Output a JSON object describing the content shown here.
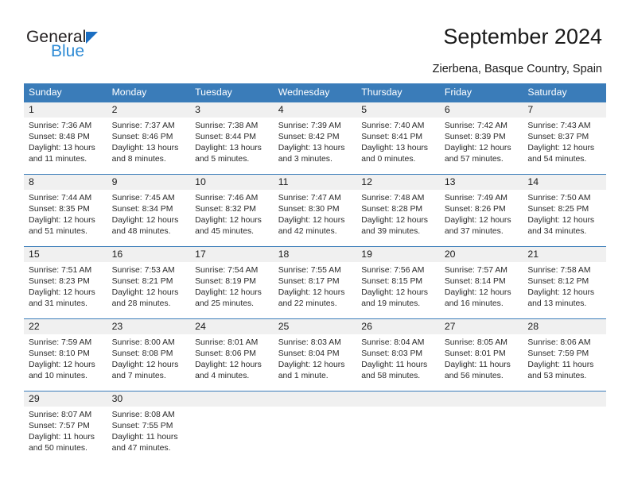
{
  "brand": {
    "name_part1": "General",
    "name_part2": "Blue",
    "triangle_color": "#1b6ec2",
    "blue_text_color": "#2e8bd5"
  },
  "header": {
    "title": "September 2024",
    "location": "Zierbena, Basque Country, Spain",
    "header_bg": "#3a7cb9",
    "daynum_bg": "#f0f0f0"
  },
  "weekdays": [
    "Sunday",
    "Monday",
    "Tuesday",
    "Wednesday",
    "Thursday",
    "Friday",
    "Saturday"
  ],
  "labels": {
    "sunrise": "Sunrise:",
    "sunset": "Sunset:",
    "daylight": "Daylight:"
  },
  "weeks": [
    [
      {
        "day": "1",
        "sunrise": "Sunrise: 7:36 AM",
        "sunset": "Sunset: 8:48 PM",
        "daylight1": "Daylight: 13 hours",
        "daylight2": "and 11 minutes."
      },
      {
        "day": "2",
        "sunrise": "Sunrise: 7:37 AM",
        "sunset": "Sunset: 8:46 PM",
        "daylight1": "Daylight: 13 hours",
        "daylight2": "and 8 minutes."
      },
      {
        "day": "3",
        "sunrise": "Sunrise: 7:38 AM",
        "sunset": "Sunset: 8:44 PM",
        "daylight1": "Daylight: 13 hours",
        "daylight2": "and 5 minutes."
      },
      {
        "day": "4",
        "sunrise": "Sunrise: 7:39 AM",
        "sunset": "Sunset: 8:42 PM",
        "daylight1": "Daylight: 13 hours",
        "daylight2": "and 3 minutes."
      },
      {
        "day": "5",
        "sunrise": "Sunrise: 7:40 AM",
        "sunset": "Sunset: 8:41 PM",
        "daylight1": "Daylight: 13 hours",
        "daylight2": "and 0 minutes."
      },
      {
        "day": "6",
        "sunrise": "Sunrise: 7:42 AM",
        "sunset": "Sunset: 8:39 PM",
        "daylight1": "Daylight: 12 hours",
        "daylight2": "and 57 minutes."
      },
      {
        "day": "7",
        "sunrise": "Sunrise: 7:43 AM",
        "sunset": "Sunset: 8:37 PM",
        "daylight1": "Daylight: 12 hours",
        "daylight2": "and 54 minutes."
      }
    ],
    [
      {
        "day": "8",
        "sunrise": "Sunrise: 7:44 AM",
        "sunset": "Sunset: 8:35 PM",
        "daylight1": "Daylight: 12 hours",
        "daylight2": "and 51 minutes."
      },
      {
        "day": "9",
        "sunrise": "Sunrise: 7:45 AM",
        "sunset": "Sunset: 8:34 PM",
        "daylight1": "Daylight: 12 hours",
        "daylight2": "and 48 minutes."
      },
      {
        "day": "10",
        "sunrise": "Sunrise: 7:46 AM",
        "sunset": "Sunset: 8:32 PM",
        "daylight1": "Daylight: 12 hours",
        "daylight2": "and 45 minutes."
      },
      {
        "day": "11",
        "sunrise": "Sunrise: 7:47 AM",
        "sunset": "Sunset: 8:30 PM",
        "daylight1": "Daylight: 12 hours",
        "daylight2": "and 42 minutes."
      },
      {
        "day": "12",
        "sunrise": "Sunrise: 7:48 AM",
        "sunset": "Sunset: 8:28 PM",
        "daylight1": "Daylight: 12 hours",
        "daylight2": "and 39 minutes."
      },
      {
        "day": "13",
        "sunrise": "Sunrise: 7:49 AM",
        "sunset": "Sunset: 8:26 PM",
        "daylight1": "Daylight: 12 hours",
        "daylight2": "and 37 minutes."
      },
      {
        "day": "14",
        "sunrise": "Sunrise: 7:50 AM",
        "sunset": "Sunset: 8:25 PM",
        "daylight1": "Daylight: 12 hours",
        "daylight2": "and 34 minutes."
      }
    ],
    [
      {
        "day": "15",
        "sunrise": "Sunrise: 7:51 AM",
        "sunset": "Sunset: 8:23 PM",
        "daylight1": "Daylight: 12 hours",
        "daylight2": "and 31 minutes."
      },
      {
        "day": "16",
        "sunrise": "Sunrise: 7:53 AM",
        "sunset": "Sunset: 8:21 PM",
        "daylight1": "Daylight: 12 hours",
        "daylight2": "and 28 minutes."
      },
      {
        "day": "17",
        "sunrise": "Sunrise: 7:54 AM",
        "sunset": "Sunset: 8:19 PM",
        "daylight1": "Daylight: 12 hours",
        "daylight2": "and 25 minutes."
      },
      {
        "day": "18",
        "sunrise": "Sunrise: 7:55 AM",
        "sunset": "Sunset: 8:17 PM",
        "daylight1": "Daylight: 12 hours",
        "daylight2": "and 22 minutes."
      },
      {
        "day": "19",
        "sunrise": "Sunrise: 7:56 AM",
        "sunset": "Sunset: 8:15 PM",
        "daylight1": "Daylight: 12 hours",
        "daylight2": "and 19 minutes."
      },
      {
        "day": "20",
        "sunrise": "Sunrise: 7:57 AM",
        "sunset": "Sunset: 8:14 PM",
        "daylight1": "Daylight: 12 hours",
        "daylight2": "and 16 minutes."
      },
      {
        "day": "21",
        "sunrise": "Sunrise: 7:58 AM",
        "sunset": "Sunset: 8:12 PM",
        "daylight1": "Daylight: 12 hours",
        "daylight2": "and 13 minutes."
      }
    ],
    [
      {
        "day": "22",
        "sunrise": "Sunrise: 7:59 AM",
        "sunset": "Sunset: 8:10 PM",
        "daylight1": "Daylight: 12 hours",
        "daylight2": "and 10 minutes."
      },
      {
        "day": "23",
        "sunrise": "Sunrise: 8:00 AM",
        "sunset": "Sunset: 8:08 PM",
        "daylight1": "Daylight: 12 hours",
        "daylight2": "and 7 minutes."
      },
      {
        "day": "24",
        "sunrise": "Sunrise: 8:01 AM",
        "sunset": "Sunset: 8:06 PM",
        "daylight1": "Daylight: 12 hours",
        "daylight2": "and 4 minutes."
      },
      {
        "day": "25",
        "sunrise": "Sunrise: 8:03 AM",
        "sunset": "Sunset: 8:04 PM",
        "daylight1": "Daylight: 12 hours",
        "daylight2": "and 1 minute."
      },
      {
        "day": "26",
        "sunrise": "Sunrise: 8:04 AM",
        "sunset": "Sunset: 8:03 PM",
        "daylight1": "Daylight: 11 hours",
        "daylight2": "and 58 minutes."
      },
      {
        "day": "27",
        "sunrise": "Sunrise: 8:05 AM",
        "sunset": "Sunset: 8:01 PM",
        "daylight1": "Daylight: 11 hours",
        "daylight2": "and 56 minutes."
      },
      {
        "day": "28",
        "sunrise": "Sunrise: 8:06 AM",
        "sunset": "Sunset: 7:59 PM",
        "daylight1": "Daylight: 11 hours",
        "daylight2": "and 53 minutes."
      }
    ],
    [
      {
        "day": "29",
        "sunrise": "Sunrise: 8:07 AM",
        "sunset": "Sunset: 7:57 PM",
        "daylight1": "Daylight: 11 hours",
        "daylight2": "and 50 minutes."
      },
      {
        "day": "30",
        "sunrise": "Sunrise: 8:08 AM",
        "sunset": "Sunset: 7:55 PM",
        "daylight1": "Daylight: 11 hours",
        "daylight2": "and 47 minutes."
      },
      {
        "day": "",
        "sunrise": "",
        "sunset": "",
        "daylight1": "",
        "daylight2": ""
      },
      {
        "day": "",
        "sunrise": "",
        "sunset": "",
        "daylight1": "",
        "daylight2": ""
      },
      {
        "day": "",
        "sunrise": "",
        "sunset": "",
        "daylight1": "",
        "daylight2": ""
      },
      {
        "day": "",
        "sunrise": "",
        "sunset": "",
        "daylight1": "",
        "daylight2": ""
      },
      {
        "day": "",
        "sunrise": "",
        "sunset": "",
        "daylight1": "",
        "daylight2": ""
      }
    ]
  ]
}
